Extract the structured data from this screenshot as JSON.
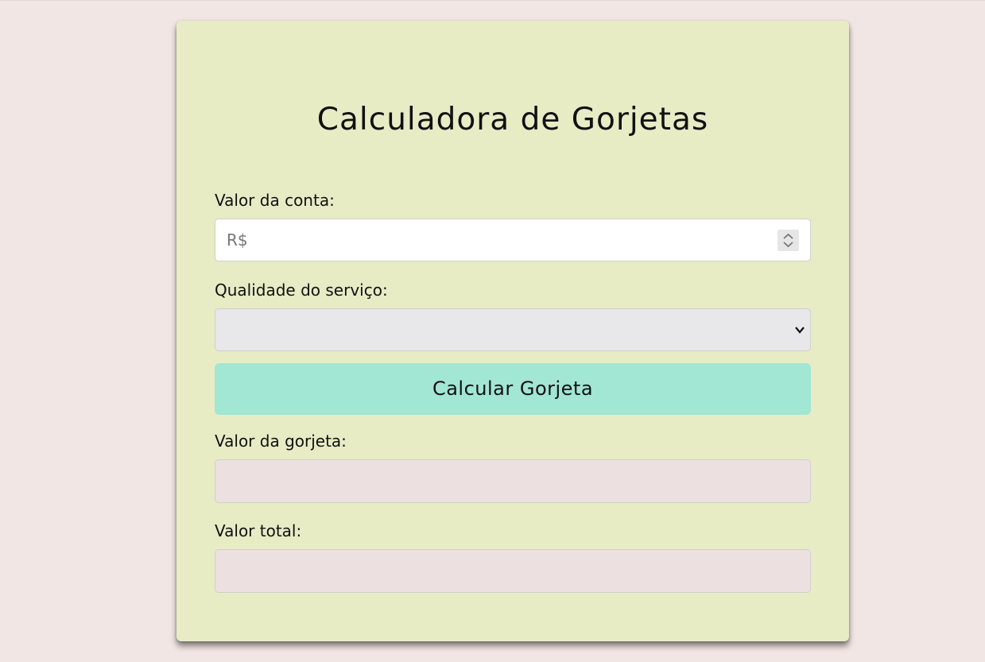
{
  "form": {
    "title": "Calculadora de Gorjetas",
    "bill_label": "Valor da conta:",
    "bill_placeholder": "R$",
    "bill_value": "",
    "quality_label": "Qualidade do serviço:",
    "quality_selected": "",
    "calculate_label": "Calcular Gorjeta",
    "tip_label": "Valor da gorjeta:",
    "tip_value": "",
    "total_label": "Valor total:",
    "total_value": ""
  },
  "icons": {
    "spinner": "stepper-arrows-icon",
    "dropdown": "chevron-down-icon"
  },
  "colors": {
    "page_background": "#f2e6e4",
    "card_background": "#e7ecc5",
    "button_background": "#a2e6d4",
    "output_background": "#ece1e0",
    "select_background": "#e8e7ea"
  }
}
